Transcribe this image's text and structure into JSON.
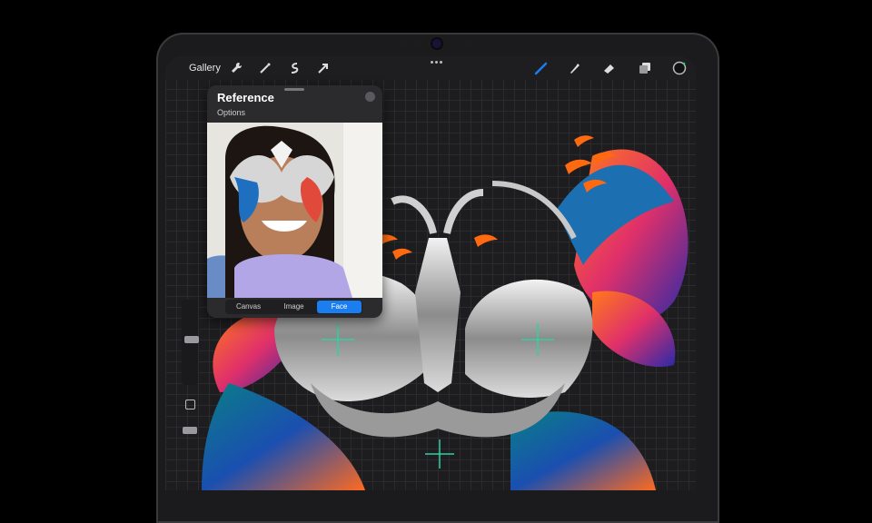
{
  "app": {
    "topbar": {
      "gallery_label": "Gallery",
      "left_tools": [
        "wrench-icon",
        "magic-wand-icon",
        "selection-icon",
        "transform-arrow-icon"
      ],
      "right_tools": [
        "brush-icon",
        "smudge-icon",
        "eraser-icon",
        "layers-icon",
        "color-swatch-icon"
      ],
      "accent": "#1a7df0"
    },
    "reference_panel": {
      "title": "Reference",
      "options_label": "Options",
      "segments": [
        "Canvas",
        "Image",
        "Face"
      ],
      "selected_segment": "Face"
    },
    "sidebar": {
      "brush_size_level": 0.45,
      "opacity_level": 0.7
    }
  }
}
